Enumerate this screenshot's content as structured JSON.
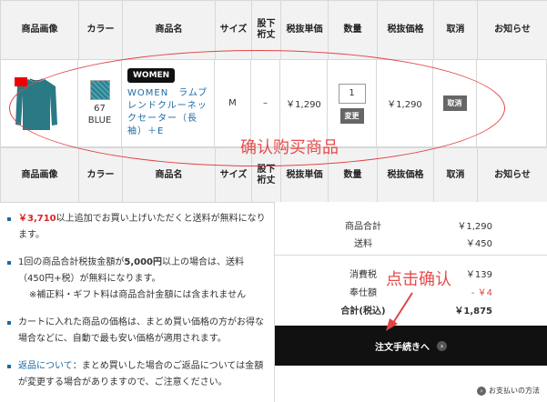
{
  "columns": [
    "商品画像",
    "カラー",
    "商品名",
    "サイズ",
    "股下\n裄丈",
    "税抜単価",
    "数量",
    "税抜価格",
    "取消",
    "お知らせ"
  ],
  "item": {
    "color_code": "67",
    "color_name": "BLUE",
    "badge": "WOMEN",
    "name": "WOMEN　ラムブレンドクルーネックセーター（長袖）＋E",
    "size": "M",
    "inseam": "–",
    "unit_price": "￥1,290",
    "quantity": "1",
    "update_label": "変更",
    "price": "￥1,290",
    "cancel_label": "取消"
  },
  "annotation_confirm": "确认购买商品",
  "annotation_click": "点击确认",
  "notes": {
    "n1_amount": "￥3,710",
    "n1_text": "以上追加でお買い上げいただくと送料が無料になります。",
    "n2_pre": "1回の商品合計税抜金額が",
    "n2_amount": "5,000円",
    "n2_post": "以上の場合は、送料（450円+税）が無料になります。",
    "n2_sub": "※補正料・ギフト料は商品合計金額には含まれません",
    "n3_text": "カートに入れた商品の価格は、まとめ買い価格の方がお得な場合などに、自動で最も安い価格が適用されます。",
    "n4_link": "返品について",
    "n4_text": "：まとめ買いした場合のご返品については金額が変更する場合がありますので、ご注意ください。"
  },
  "summary": {
    "subtotal_label": "商品合計",
    "subtotal": "￥1,290",
    "shipping_label": "送料",
    "shipping": "￥450",
    "tax_label": "消費税",
    "tax": "￥139",
    "discount_label": "奉仕額",
    "discount": "- ￥4",
    "total_label": "合計(税込)",
    "total": "￥1,875",
    "order_button": "注文手続きへ",
    "help_link": "お支払いの方法"
  }
}
